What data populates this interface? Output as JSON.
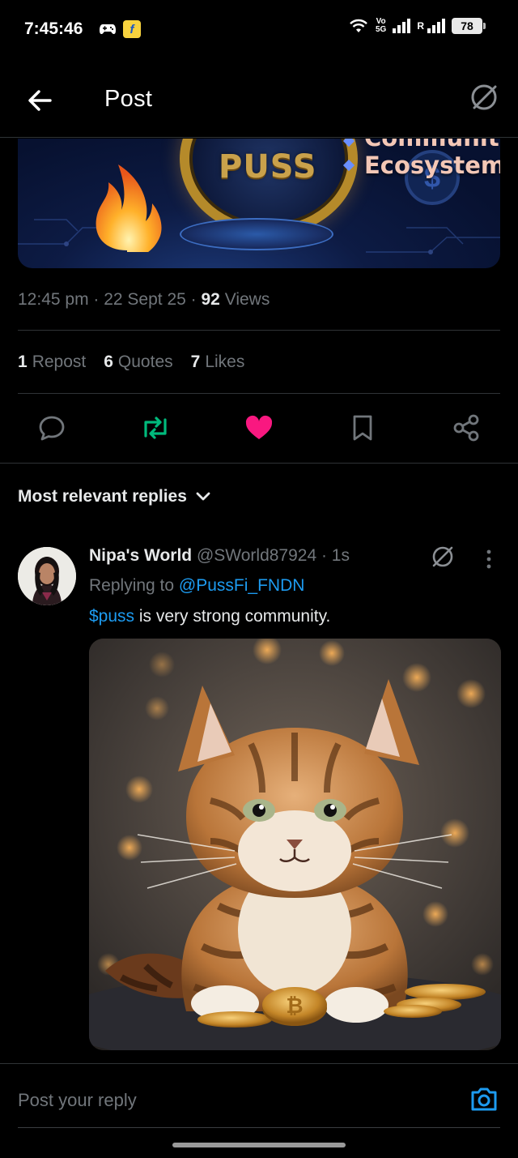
{
  "status_bar": {
    "time": "7:45:46",
    "volte_top": "Vo",
    "volte_bottom": "5G",
    "roaming": "R",
    "battery": "78"
  },
  "header": {
    "title": "Post"
  },
  "banner": {
    "coin_text": "PUSS",
    "bullet_top": "Community",
    "bullet_bottom": "Ecosystem",
    "dollar": "$"
  },
  "meta": {
    "time": "12:45 pm",
    "sep1": " · ",
    "date": "22 Sept 25",
    "sep2": " · ",
    "views_count": "92",
    "views_label": " Views"
  },
  "stats": {
    "reposts_count": "1",
    "reposts_label": "Repost",
    "quotes_count": "6",
    "quotes_label": "Quotes",
    "likes_count": "7",
    "likes_label": "Likes"
  },
  "actions": {
    "reply": "reply-icon",
    "repost": "repost-icon",
    "like": "heart-icon",
    "bookmark": "bookmark-icon",
    "share": "share-icon",
    "repost_color": "#00ba7c",
    "like_color": "#f91880"
  },
  "replies_sort": {
    "label": "Most relevant replies"
  },
  "reply": {
    "name": "Nipa's World",
    "handle": " @SWorld87924",
    "time": " · 1s",
    "replying_prefix": "Replying to ",
    "replying_to": "@PussFi_FNDN",
    "cashtag": "$puss",
    "text": " is very strong community."
  },
  "composer": {
    "placeholder": "Post your reply"
  },
  "colors": {
    "accent": "#1d9bf0",
    "background": "#000000",
    "muted": "#71767b",
    "divider": "#2f3336"
  }
}
